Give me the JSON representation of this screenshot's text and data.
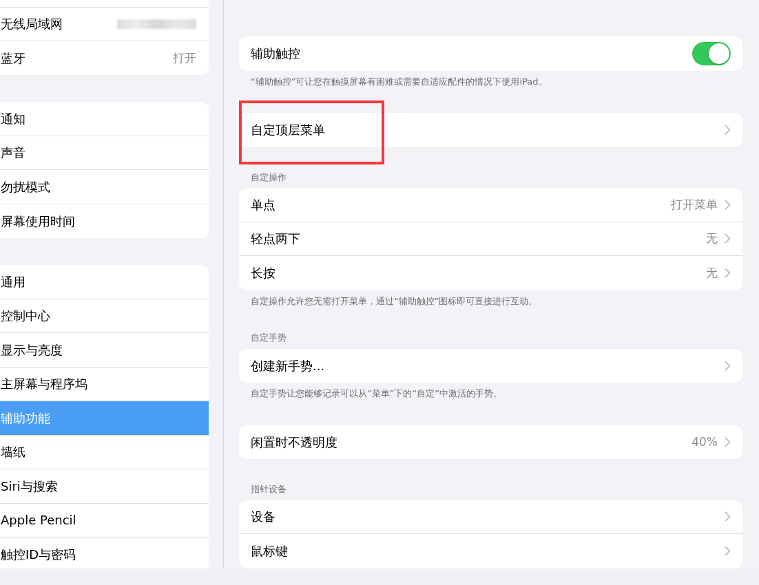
{
  "sidebar": {
    "groups": [
      {
        "items": [
          {
            "label": "无线局域网",
            "kind": "redacted",
            "selected": false
          },
          {
            "label": "蓝牙",
            "value": "打开",
            "selected": false
          }
        ]
      },
      {
        "items": [
          {
            "label": "通知",
            "selected": false
          },
          {
            "label": "声音",
            "selected": false
          },
          {
            "label": "勿扰模式",
            "selected": false
          },
          {
            "label": "屏幕使用时间",
            "selected": false
          }
        ]
      },
      {
        "items": [
          {
            "label": "通用",
            "selected": false
          },
          {
            "label": "控制中心",
            "selected": false
          },
          {
            "label": "显示与亮度",
            "selected": false
          },
          {
            "label": "主屏幕与程序坞",
            "selected": false
          },
          {
            "label": "辅助功能",
            "selected": true
          },
          {
            "label": "墙纸",
            "selected": false
          },
          {
            "label": "Siri与搜索",
            "selected": false
          },
          {
            "label": "Apple Pencil",
            "selected": false
          },
          {
            "label": "触控ID与密码",
            "selected": false
          }
        ]
      }
    ]
  },
  "detail": {
    "sections": [
      {
        "rows": [
          {
            "label": "辅助触控",
            "kind": "toggle",
            "on": true
          }
        ],
        "footer": "“辅助触控”可让您在触摸屏幕有困难或需要自适应配件的情况下使用iPad。"
      },
      {
        "highlighted": true,
        "rows": [
          {
            "label": "自定顶层菜单",
            "kind": "link"
          }
        ]
      },
      {
        "header": "自定操作",
        "rows": [
          {
            "label": "单点",
            "value": "打开菜单",
            "kind": "link"
          },
          {
            "label": "轻点两下",
            "value": "无",
            "kind": "link"
          },
          {
            "label": "长按",
            "value": "无",
            "kind": "link"
          }
        ],
        "footer": "自定操作允许您无需打开菜单，通过“辅助触控”图标即可直接进行互动。"
      },
      {
        "header": "自定手势",
        "rows": [
          {
            "label": "创建新手势...",
            "kind": "link"
          }
        ],
        "footer": "自定手势让您能够记录可以从“菜单”下的“自定”中激活的手势。"
      },
      {
        "rows": [
          {
            "label": "闲置时不透明度",
            "value": "40%",
            "kind": "link"
          }
        ]
      },
      {
        "header": "指针设备",
        "rows": [
          {
            "label": "设备",
            "kind": "link"
          },
          {
            "label": "鼠标键",
            "kind": "link"
          }
        ]
      }
    ]
  }
}
